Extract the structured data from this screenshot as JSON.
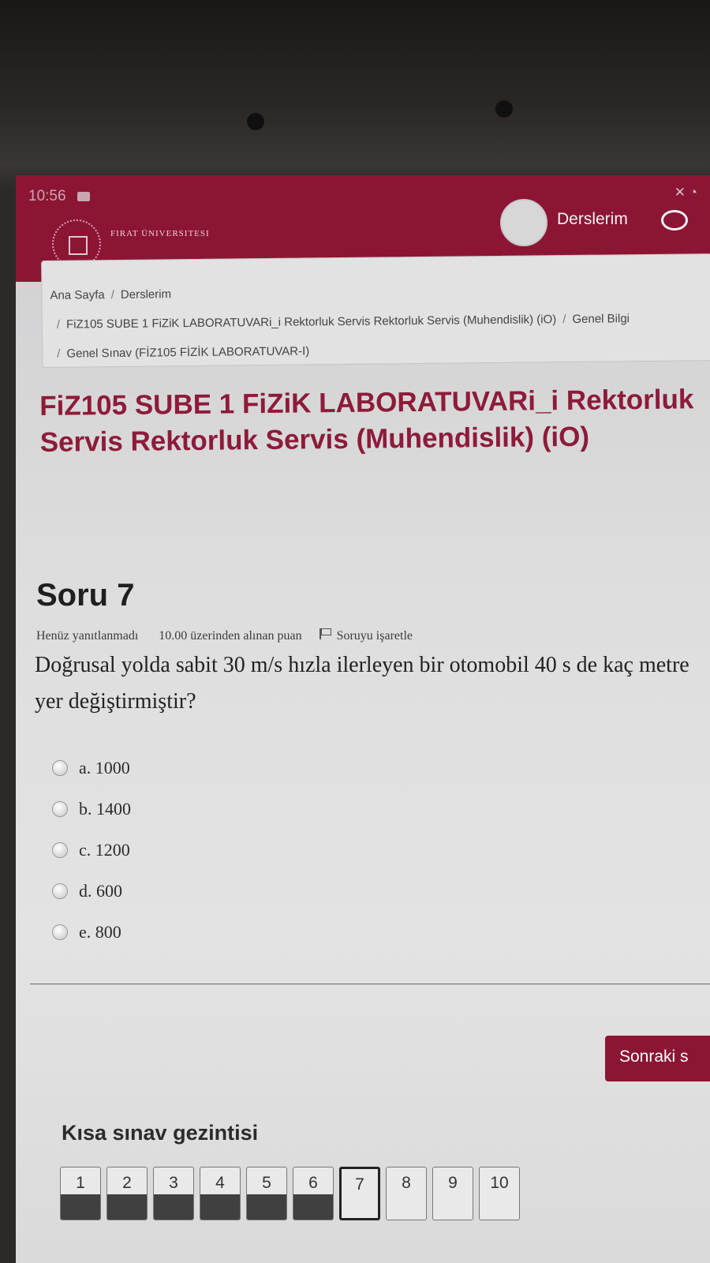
{
  "status_bar": {
    "time": "10:56"
  },
  "header": {
    "logo_text": "FIRAT ÜNIVERSITESI",
    "my_courses": "Derslerim"
  },
  "breadcrumb": {
    "items": [
      "Ana Sayfa",
      "Derslerim",
      "FiZ105 SUBE 1 FiZiK LABORATUVARi_i Rektorluk Servis Rektorluk Servis (Muhendislik) (iO)",
      "Genel Bilgi",
      "Genel Sınav (FİZ105 FİZİK LABORATUVAR-I)"
    ]
  },
  "course": {
    "title": "FiZ105 SUBE 1 FiZiK LABORATUVARi_i Rektorluk Servis Rektorluk Servis (Muhendislik) (iO)"
  },
  "question": {
    "title": "Soru 7",
    "status": "Henüz yanıtlanmadı",
    "points": "10.00 üzerinden alınan puan",
    "flag_label": "Soruyu işaretle",
    "text": "Doğrusal yolda sabit 30 m/s hızla ilerleyen bir otomobil 40 s de kaç metre yer değiştirmiştir?",
    "options": [
      "a. 1000",
      "b. 1400",
      "c. 1200",
      "d. 600",
      "e. 800"
    ]
  },
  "next_button": "Sonraki s",
  "quiz_nav": {
    "title": "Kısa sınav gezintisi",
    "questions": [
      {
        "num": "1",
        "answered": true,
        "current": false
      },
      {
        "num": "2",
        "answered": true,
        "current": false
      },
      {
        "num": "3",
        "answered": true,
        "current": false
      },
      {
        "num": "4",
        "answered": true,
        "current": false
      },
      {
        "num": "5",
        "answered": true,
        "current": false
      },
      {
        "num": "6",
        "answered": true,
        "current": false
      },
      {
        "num": "7",
        "answered": false,
        "current": true
      },
      {
        "num": "8",
        "answered": false,
        "current": false
      },
      {
        "num": "9",
        "answered": false,
        "current": false
      },
      {
        "num": "10",
        "answered": false,
        "current": false
      }
    ]
  },
  "colors": {
    "brand": "#8c1534",
    "title_text": "#8d1b39"
  }
}
